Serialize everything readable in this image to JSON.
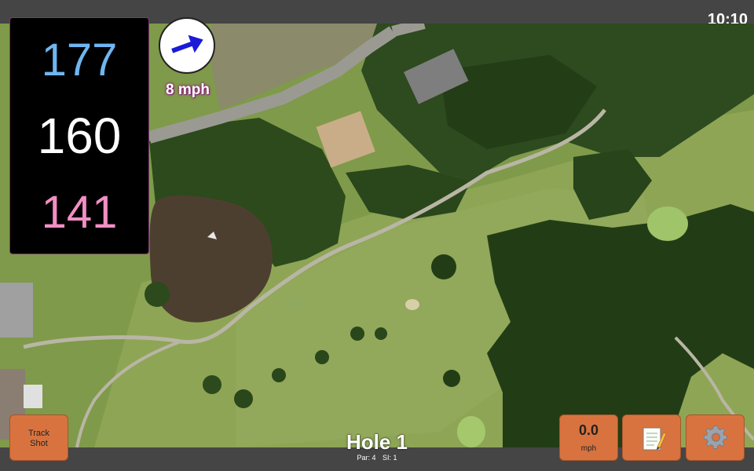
{
  "status": {
    "time": "10:10"
  },
  "distances": {
    "back": "177",
    "center": "160",
    "front": "141"
  },
  "wind": {
    "speed_label": "8 mph",
    "direction_icon": "arrow-icon"
  },
  "hole": {
    "title": "Hole 1",
    "par_label": "Par: 4",
    "si_label": "SI: 1"
  },
  "buttons": {
    "track_shot_line1": "Track",
    "track_shot_line2": "Shot",
    "wind_value": "0.0",
    "wind_unit": "mph",
    "notes_icon": "memo-icon",
    "settings_icon": "gear-icon"
  },
  "colors": {
    "back": "#6fb6f0",
    "center": "#ffffff",
    "front": "#f38ec4",
    "button": "#d8733f"
  }
}
